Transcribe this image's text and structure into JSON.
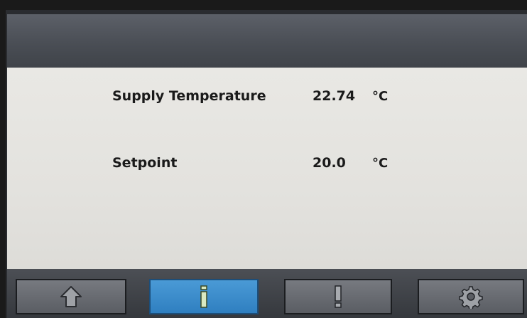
{
  "rows": [
    {
      "label": "Supply Temperature",
      "value": "22.74",
      "unit": "°C"
    },
    {
      "label": "Setpoint",
      "value": "20.0",
      "unit": "°C"
    }
  ],
  "nav": [
    {
      "icon": "home-icon",
      "active": false
    },
    {
      "icon": "info-icon",
      "active": true
    },
    {
      "icon": "alarm-icon",
      "active": false
    },
    {
      "icon": "gear-icon",
      "active": false
    }
  ],
  "colors": {
    "header": "#4a4e55",
    "content_bg": "#e5e4e0",
    "active_tab": "#3a8ccb",
    "inactive_tab": "#676a70"
  }
}
